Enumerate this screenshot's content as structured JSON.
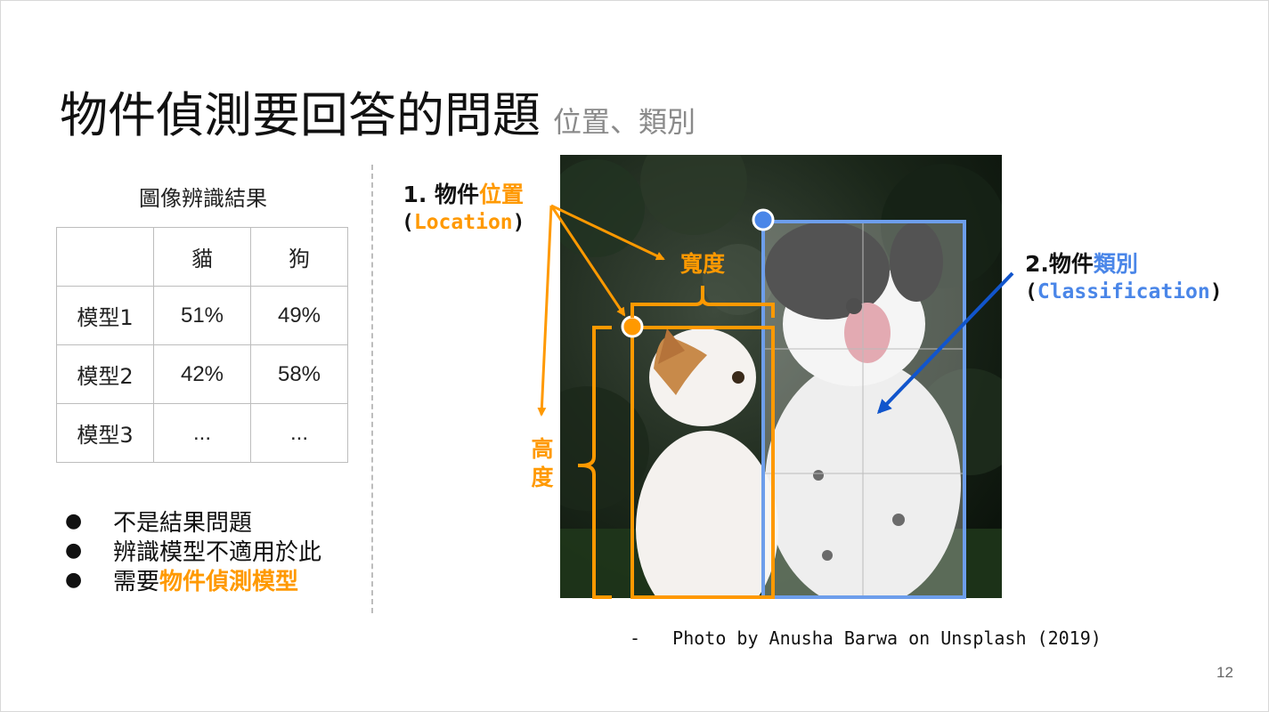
{
  "title": {
    "main": "物件偵測要回答的問題",
    "sub": "位置、類別"
  },
  "table": {
    "caption": "圖像辨識結果",
    "header": [
      "",
      "貓",
      "狗"
    ],
    "rows": [
      [
        "模型1",
        "51%",
        "49%"
      ],
      [
        "模型2",
        "42%",
        "58%"
      ],
      [
        "模型3",
        "...",
        "..."
      ]
    ]
  },
  "bullets": {
    "marker": "●",
    "items": [
      {
        "text": "不是結果問題",
        "highlight": ""
      },
      {
        "text": "辨識模型不適用於此",
        "highlight": ""
      },
      {
        "text": "需要",
        "highlight": "物件偵測模型"
      }
    ]
  },
  "annotations": {
    "location": {
      "prefix": "1. 物件",
      "highlight": "位置",
      "english": "(Location)"
    },
    "classification": {
      "prefix": "2.物件",
      "highlight": "類別",
      "english": "(Classification)"
    },
    "width": "寬度",
    "height": [
      "高",
      "度"
    ]
  },
  "credit": "-   Photo by Anusha Barwa on Unsplash (2019)",
  "page_number": "12",
  "colors": {
    "orange": "#ff9900",
    "blue": "#4a86e8",
    "arrow_blue": "#1155cc",
    "gray": "#8a8a8a"
  }
}
